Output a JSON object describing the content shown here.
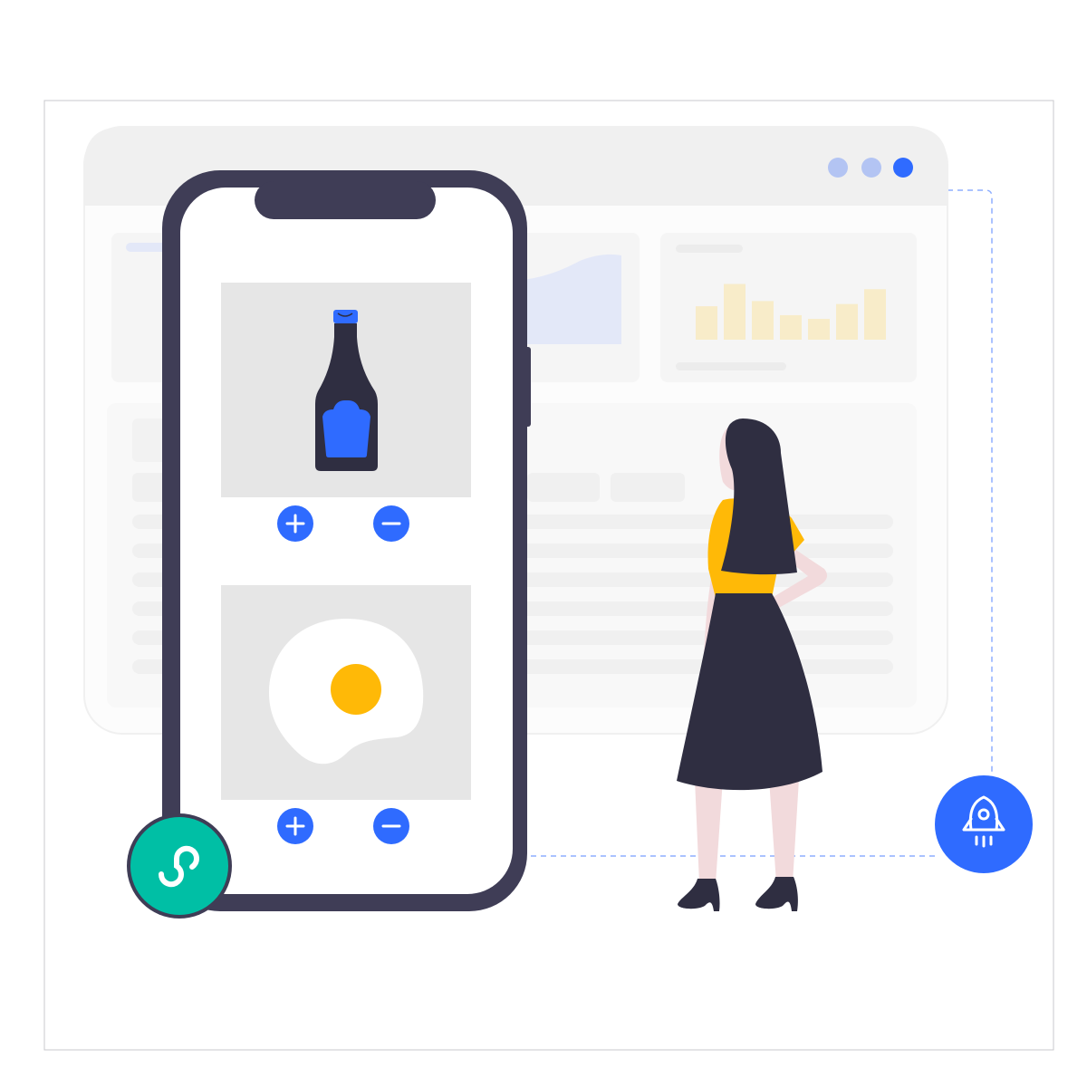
{
  "colors": {
    "background": "#ffffff",
    "frame_border": "#c8c8cc",
    "browser_chrome": "#f0f0f0",
    "browser_body": "#fcfcfc",
    "card": "#f5f5f5",
    "placeholder_bar": "#ececec",
    "accent_blue": "#2f6bff",
    "dot_light": "#b3c4f3",
    "area_fill": "#e3e8f8",
    "bar_fill": "#f8ecc9",
    "phone_frame": "#3f3d56",
    "screen": "#ffffff",
    "product_bg": "#e6e6e6",
    "bottle": "#2f2e41",
    "egg_yolk": "#ffb907",
    "mini_program_green": "#00bfa5",
    "skin": "#f2dadc",
    "hair": "#2f2e41",
    "top": "#ffb907",
    "skirt": "#2f2e41"
  },
  "browser": {
    "window_dots": [
      "dot-light",
      "dot-light",
      "dot-active"
    ],
    "bar_chart_values": [
      0.45,
      0.75,
      0.52,
      0.33,
      0.28,
      0.48,
      0.68
    ]
  },
  "phone": {
    "products": [
      {
        "name": "sauce-bottle",
        "controls": [
          "add",
          "remove"
        ]
      },
      {
        "name": "fried-egg",
        "controls": [
          "add",
          "remove"
        ]
      }
    ]
  },
  "icons": {
    "mini_program": "mini-program-icon",
    "rocket": "rocket-icon",
    "plus": "plus-icon",
    "minus": "minus-icon"
  }
}
